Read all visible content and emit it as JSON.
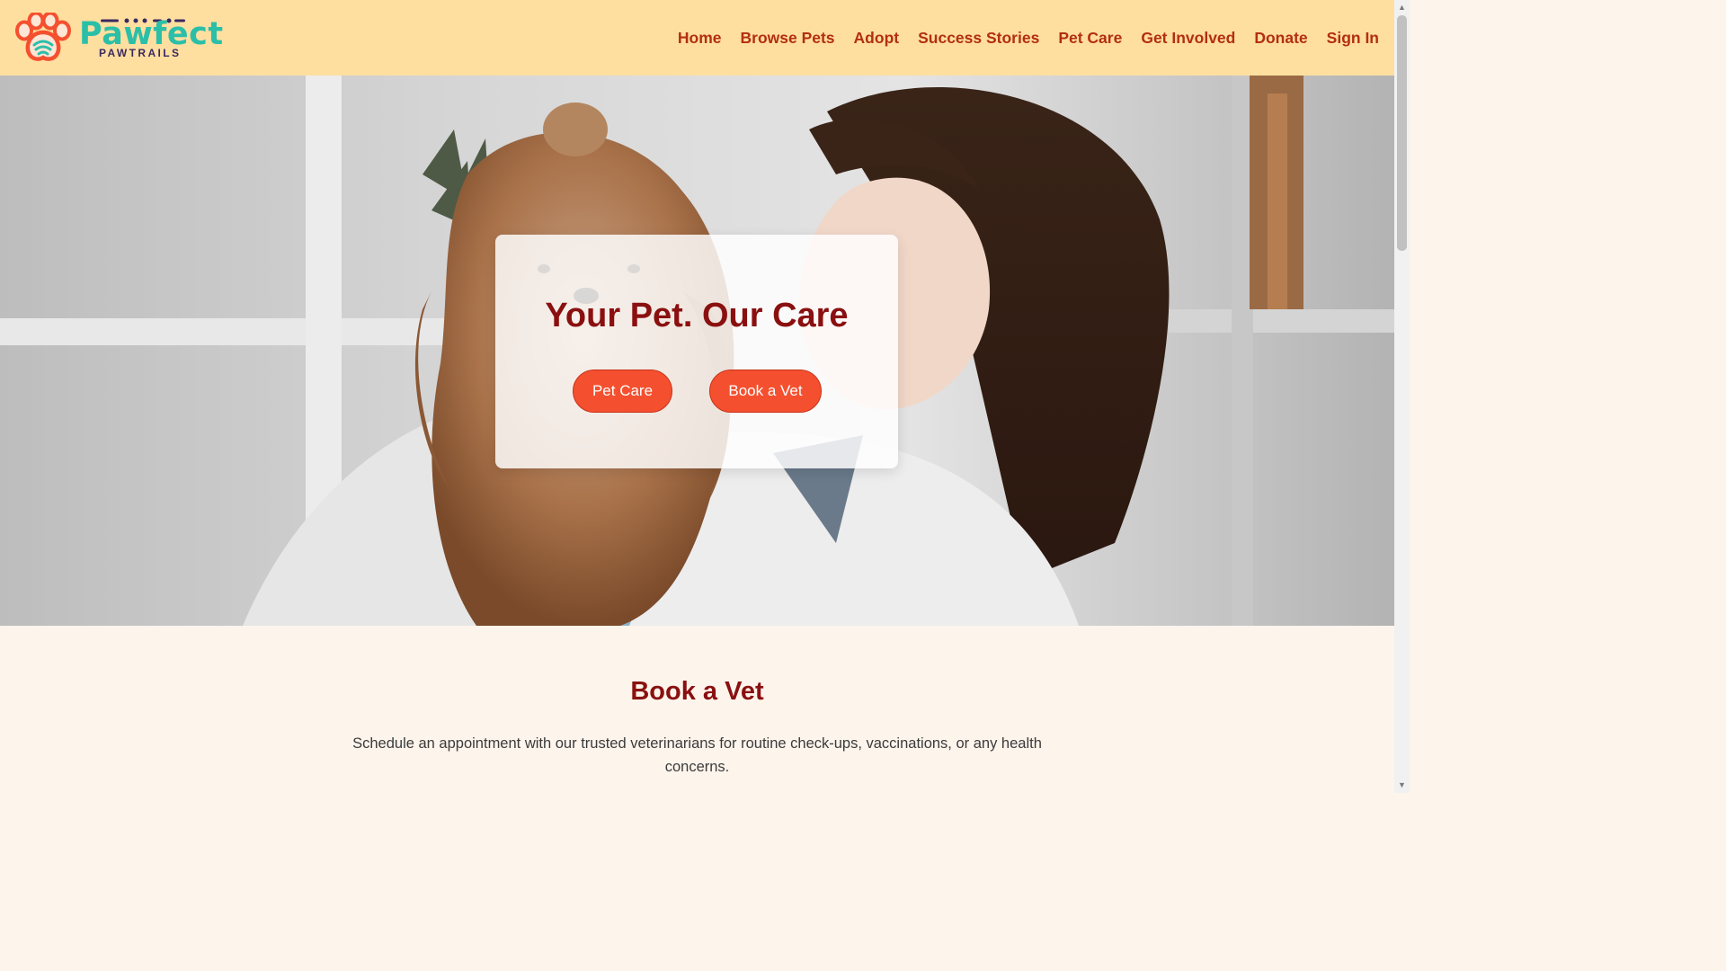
{
  "brand": {
    "name": "Pawfect",
    "tagline": "PAWTRAILS",
    "colors": {
      "primary": "#2bbfa8",
      "accent": "#f4502f",
      "dark": "#8a1010",
      "header_bg": "#ffdfa0"
    }
  },
  "nav": {
    "items": [
      {
        "label": "Home"
      },
      {
        "label": "Browse Pets"
      },
      {
        "label": "Adopt"
      },
      {
        "label": "Success Stories"
      },
      {
        "label": "Pet Care"
      },
      {
        "label": "Get Involved"
      },
      {
        "label": "Donate"
      },
      {
        "label": "Sign In"
      }
    ]
  },
  "hero": {
    "title": "Your Pet. Our Care",
    "buttons": {
      "pet_care": "Pet Care",
      "book_vet": "Book a Vet"
    },
    "image": "veterinarian-holding-yorkshire-terrier-photo"
  },
  "book_vet": {
    "title": "Book a Vet",
    "description": "Schedule an appointment with our trusted veterinarians for routine check-ups, vaccinations, or any health concerns."
  },
  "scrollbar": {
    "up_icon": "arrow-up-icon",
    "down_icon": "arrow-down-icon"
  }
}
